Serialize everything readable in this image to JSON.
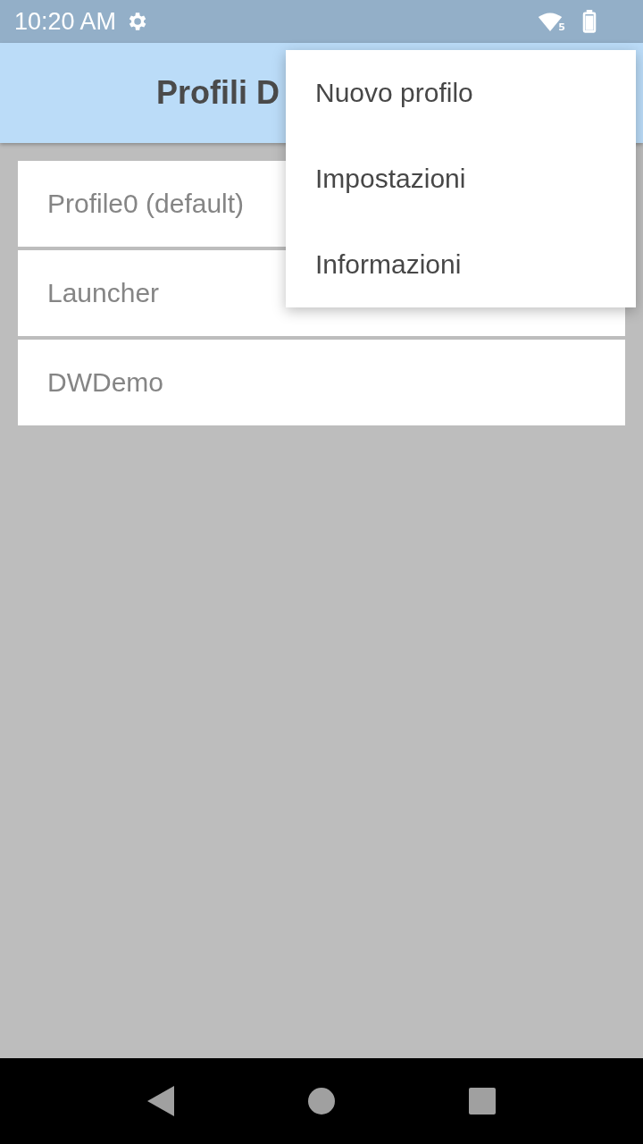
{
  "status_bar": {
    "time": "10:20 AM",
    "wifi_badge": "5"
  },
  "app_bar": {
    "title": "Profili D"
  },
  "profiles": [
    {
      "name": "Profile0 (default)"
    },
    {
      "name": "Launcher"
    },
    {
      "name": "DWDemo"
    }
  ],
  "menu": {
    "items": [
      {
        "label": "Nuovo profilo"
      },
      {
        "label": "Impostazioni"
      },
      {
        "label": "Informazioni"
      }
    ]
  }
}
